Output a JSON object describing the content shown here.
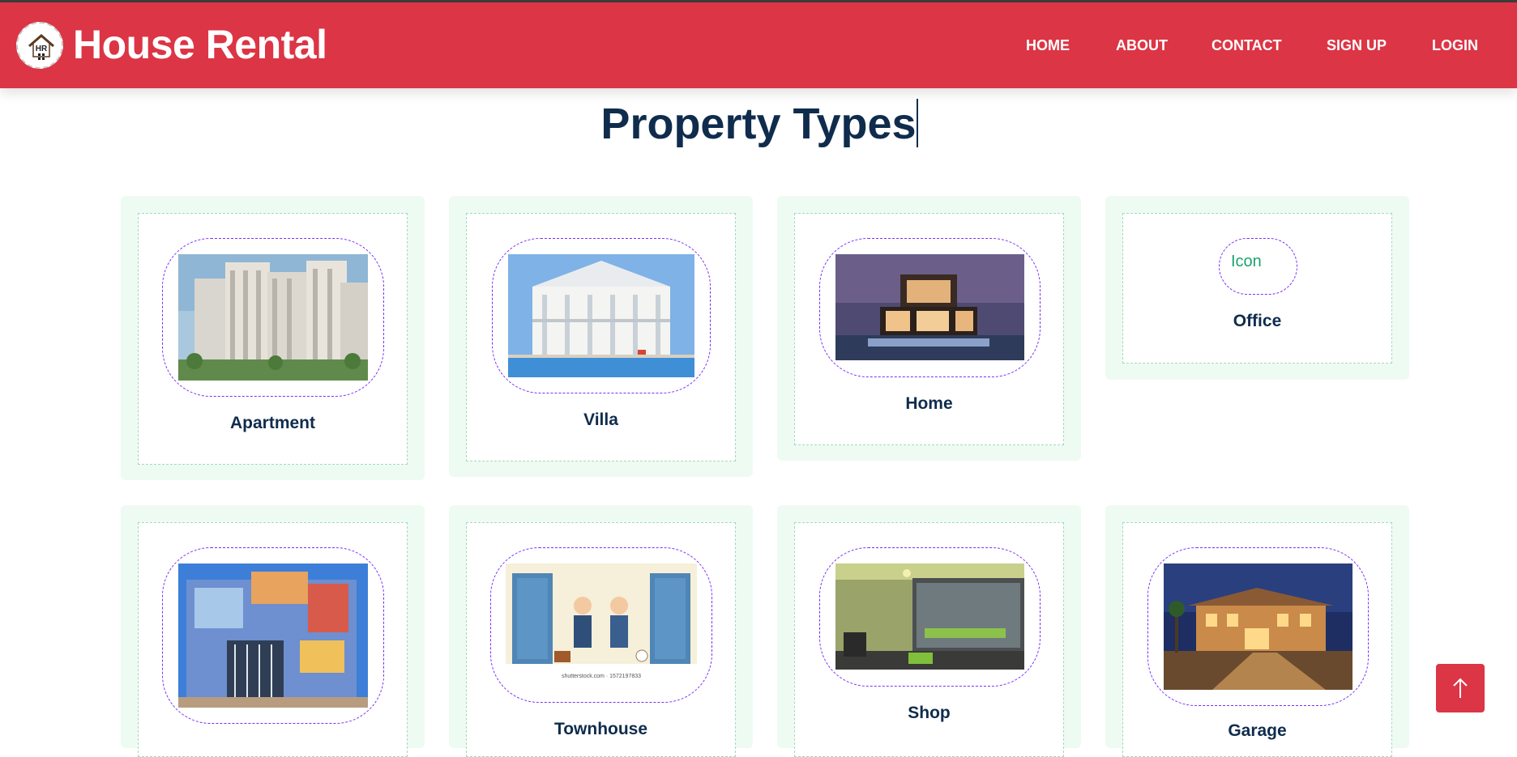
{
  "brand": {
    "name": "House Rental",
    "logo_text": "HR"
  },
  "nav": {
    "home": "HOME",
    "about": "ABOUT",
    "contact": "CONTACT",
    "signup": "SIGN UP",
    "login": "LOGIN"
  },
  "page": {
    "title": "Property Types"
  },
  "property_types": [
    {
      "label": "Apartment"
    },
    {
      "label": "Villa"
    },
    {
      "label": "Home"
    },
    {
      "label": "Office",
      "image_alt": "Icon"
    },
    {
      "label": ""
    },
    {
      "label": "Townhouse",
      "image_caption": "shutterstock.com · 1572197833"
    },
    {
      "label": "Shop"
    },
    {
      "label": "Garage"
    }
  ],
  "colors": {
    "brand_red": "#dc3545",
    "title_navy": "#0f2c4d",
    "card_bg": "#eefbf3",
    "frame_purple": "#7b2ff7"
  },
  "icons": {
    "scroll_top": "arrow-up-icon",
    "logo": "house-icon"
  }
}
